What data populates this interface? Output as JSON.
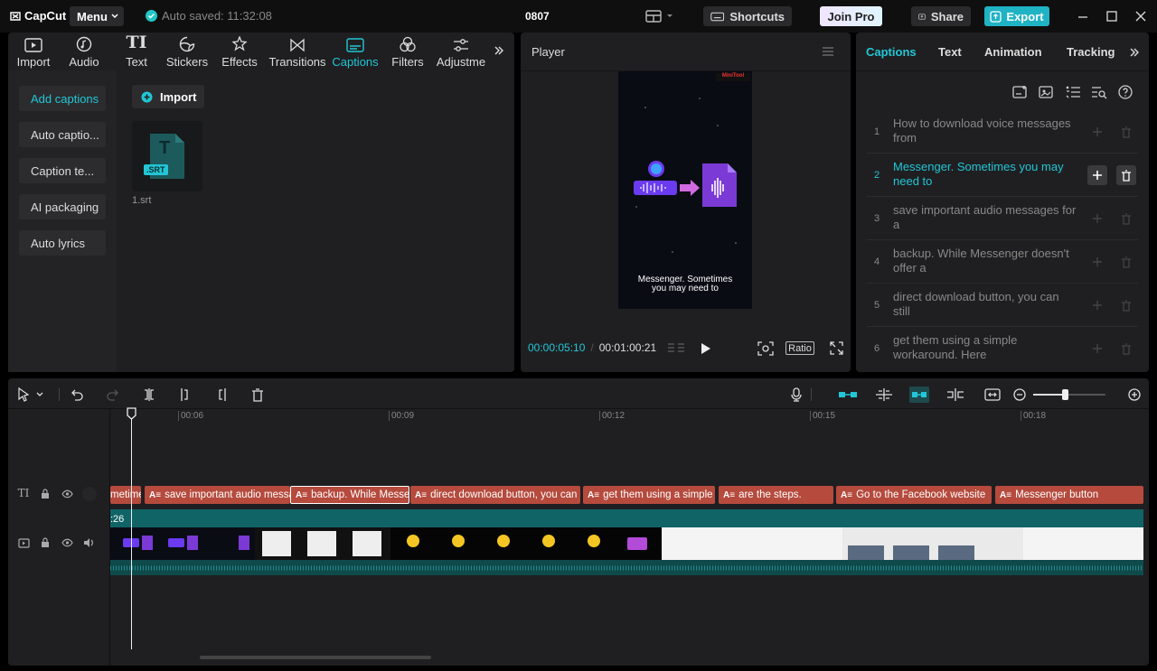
{
  "app": {
    "logo": "CapCut",
    "menu_label": "Menu",
    "autosave": "Auto saved: 11:32:08",
    "project_title": "0807"
  },
  "titlebar": {
    "shortcuts": "Shortcuts",
    "join_pro": "Join Pro",
    "share": "Share",
    "export": "Export"
  },
  "left_tabs": [
    {
      "label": "Import",
      "icon": "import-icon"
    },
    {
      "label": "Audio",
      "icon": "audio-icon"
    },
    {
      "label": "Text",
      "icon": "text-icon"
    },
    {
      "label": "Stickers",
      "icon": "stickers-icon"
    },
    {
      "label": "Effects",
      "icon": "effects-icon"
    },
    {
      "label": "Transitions",
      "icon": "transitions-icon"
    },
    {
      "label": "Captions",
      "icon": "captions-icon",
      "active": true
    },
    {
      "label": "Filters",
      "icon": "filters-icon"
    },
    {
      "label": "Adjustme",
      "icon": "adjustment-icon"
    }
  ],
  "left_sidebar": [
    {
      "label": "Add captions",
      "active": true
    },
    {
      "label": "Auto captio..."
    },
    {
      "label": "Caption te..."
    },
    {
      "label": "AI packaging"
    },
    {
      "label": "Auto lyrics"
    }
  ],
  "media": {
    "import_label": "Import",
    "file_badge": ".SRT",
    "file_letter": "T",
    "file_name": "1.srt"
  },
  "player": {
    "title": "Player",
    "watermark": "MiniTool",
    "caption_line1": "Messenger. Sometimes",
    "caption_line2": "you may need to",
    "current_time": "00:00:05:10",
    "total_time": "00:01:00:21",
    "ratio_label": "Ratio"
  },
  "right_tabs": [
    {
      "label": "Captions",
      "active": true
    },
    {
      "label": "Text"
    },
    {
      "label": "Animation"
    },
    {
      "label": "Tracking"
    }
  ],
  "captions": [
    {
      "num": "1",
      "text": "How to download voice messages from"
    },
    {
      "num": "2",
      "text": "Messenger. Sometimes you may need to",
      "active": true
    },
    {
      "num": "3",
      "text": "save important audio messages for a"
    },
    {
      "num": "4",
      "text": "backup. While Messenger doesn't offer a"
    },
    {
      "num": "5",
      "text": "direct download button, you can still"
    },
    {
      "num": "6",
      "text": "get them using a simple workaround. Here"
    }
  ],
  "timeline": {
    "ruler": [
      "00:06",
      "00:09",
      "00:12",
      "00:15",
      "00:18"
    ],
    "video_track_label": ":26",
    "caption_clips": [
      {
        "text": "metime"
      },
      {
        "text": "save important audio messages"
      },
      {
        "text": "backup. While Messenger",
        "selected": true
      },
      {
        "text": "direct download button, you can"
      },
      {
        "text": "get them using a simple"
      },
      {
        "text": "are the steps."
      },
      {
        "text": "Go to the Facebook website"
      },
      {
        "text": "Messenger button"
      }
    ]
  },
  "colors": {
    "accent": "#22c6d6",
    "caption_clip": "#b54a3d",
    "video_track": "#116466",
    "export": "#1fb3c4"
  }
}
